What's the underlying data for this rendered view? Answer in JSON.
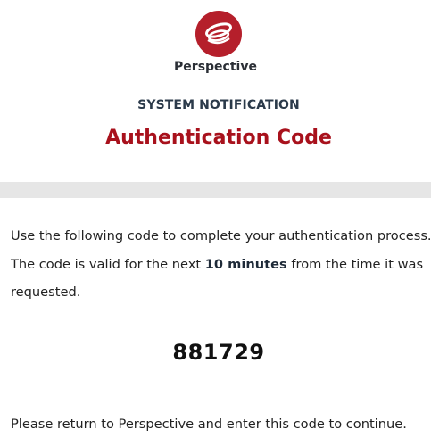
{
  "header": {
    "logo_icon": "perspective-logo-icon",
    "brand_color": "#b51f2b",
    "brand_name": "Perspective",
    "notice_label": "SYSTEM NOTIFICATION",
    "title": "Authentication Code",
    "title_color": "#a8111c"
  },
  "body": {
    "line1": "Use the following code to complete your authentication process.",
    "line2_prefix": "The code is valid for the next ",
    "line2_emphasis": "10 minutes",
    "line2_suffix": " from the time it was",
    "line3": "requested.",
    "code": "881729"
  },
  "footer": {
    "message": "Please return to Perspective and enter this code to continue."
  }
}
